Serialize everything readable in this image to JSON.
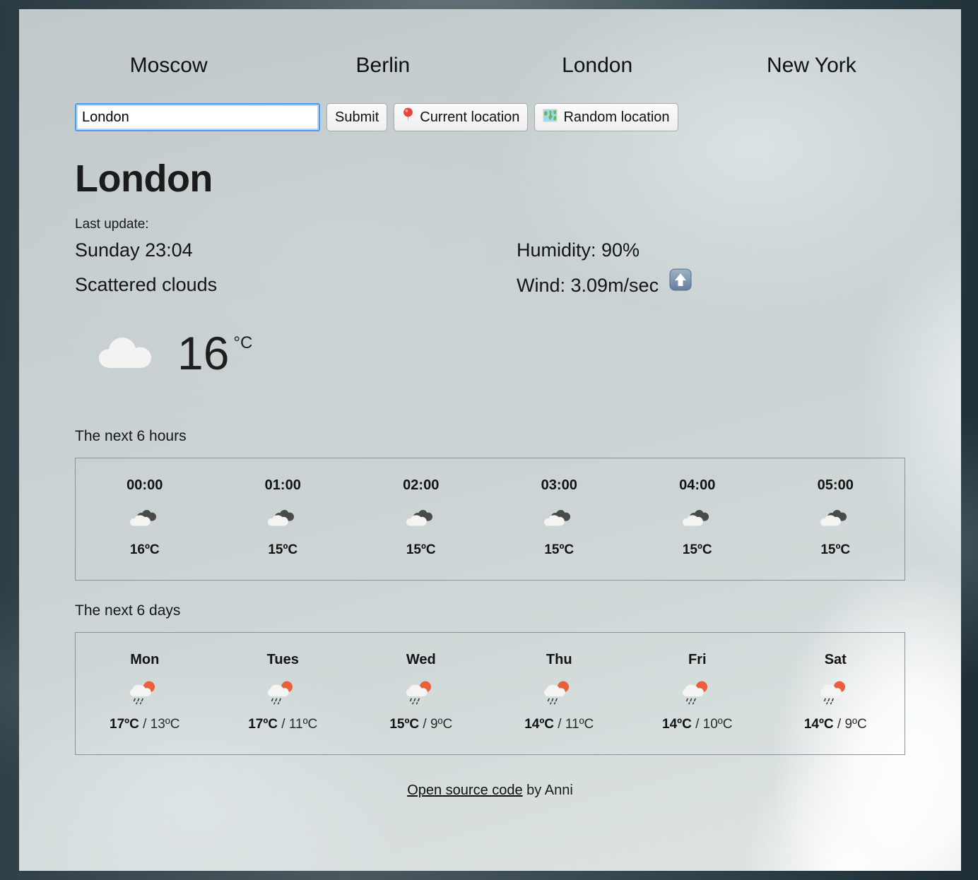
{
  "nav": {
    "cities": [
      "Moscow",
      "Berlin",
      "London",
      "New York"
    ]
  },
  "search": {
    "value": "London",
    "placeholder": "",
    "submit_label": "Submit",
    "current_location_label": "Current location",
    "current_location_icon": "round-pushpin-icon",
    "random_location_label": "Random location",
    "random_location_icon": "world-map-icon"
  },
  "current": {
    "city": "London",
    "last_update_label": "Last update:",
    "last_update_time": "Sunday 23:04",
    "condition": "Scattered clouds",
    "humidity": "Humidity: 90%",
    "wind": "Wind: 3.09m/sec",
    "wind_direction_icon": "up-arrow-icon",
    "icon": "cloud-icon",
    "temperature": "16",
    "unit": "°C"
  },
  "hourly": {
    "title": "The next 6 hours",
    "items": [
      {
        "time": "00:00",
        "icon": "broken-clouds-night-icon",
        "temp": "16ºC"
      },
      {
        "time": "01:00",
        "icon": "broken-clouds-night-icon",
        "temp": "15ºC"
      },
      {
        "time": "02:00",
        "icon": "broken-clouds-night-icon",
        "temp": "15ºC"
      },
      {
        "time": "03:00",
        "icon": "broken-clouds-night-icon",
        "temp": "15ºC"
      },
      {
        "time": "04:00",
        "icon": "broken-clouds-night-icon",
        "temp": "15ºC"
      },
      {
        "time": "05:00",
        "icon": "broken-clouds-night-icon",
        "temp": "15ºC"
      }
    ]
  },
  "daily": {
    "title": "The next 6 days",
    "items": [
      {
        "day": "Mon",
        "icon": "sun-behind-rain-cloud-icon",
        "high": "17ºC",
        "sep": " / ",
        "low": "13ºC"
      },
      {
        "day": "Tues",
        "icon": "sun-behind-rain-cloud-icon",
        "high": "17ºC",
        "sep": " / ",
        "low": "11ºC"
      },
      {
        "day": "Wed",
        "icon": "sun-behind-rain-cloud-icon",
        "high": "15ºC",
        "sep": " / ",
        "low": "9ºC"
      },
      {
        "day": "Thu",
        "icon": "sun-behind-rain-cloud-icon",
        "high": "14ºC",
        "sep": " / ",
        "low": "11ºC"
      },
      {
        "day": "Fri",
        "icon": "sun-behind-rain-cloud-icon",
        "high": "14ºC",
        "sep": " / ",
        "low": "10ºC"
      },
      {
        "day": "Sat",
        "icon": "sun-behind-rain-cloud-icon",
        "high": "14ºC",
        "sep": " / ",
        "low": "9ºC"
      }
    ]
  },
  "footer": {
    "link_label": "Open source code",
    "suffix": " by Anni"
  },
  "colors": {
    "panel_base": "#c7cfd1",
    "backdrop": "#36474f",
    "input_focus": "#4d9bf0",
    "box_border": "#8d9395",
    "sun_orange": "#e8603c",
    "cloud_white": "#f4f4f2",
    "cloud_dark": "#4a4a4a"
  }
}
